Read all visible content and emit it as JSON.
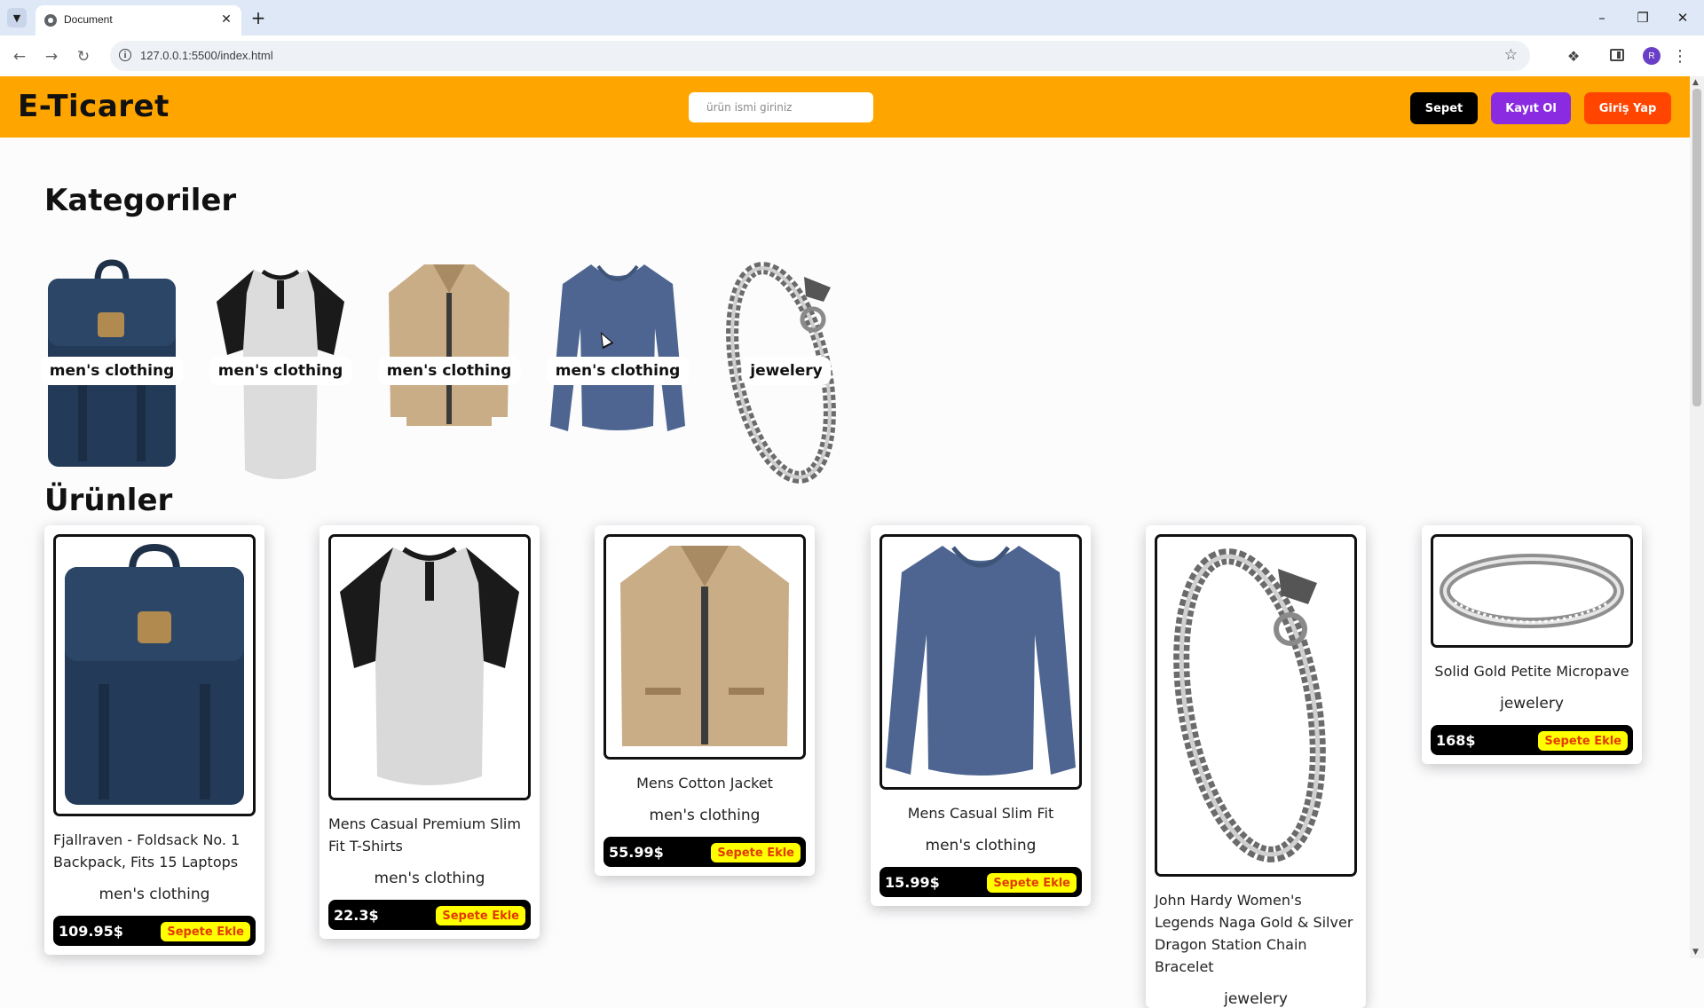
{
  "browser": {
    "tab_title": "Document",
    "url": "127.0.0.1:5500/index.html",
    "avatar_letter": "R"
  },
  "header": {
    "logo": "E-Ticaret",
    "search_placeholder": "ürün ismi giriniz",
    "cart_label": "Sepet",
    "register_label": "Kayıt Ol",
    "login_label": "Giriş Yap",
    "colors": {
      "bar": "#ffa500",
      "cart": "#000000",
      "register": "#8a2be2",
      "login": "#ff4500"
    }
  },
  "categories": {
    "title": "Kategoriler",
    "items": [
      {
        "label": "men's clothing",
        "icon": "backpack-image"
      },
      {
        "label": "men's clothing",
        "icon": "raglan-tshirt-image"
      },
      {
        "label": "men's clothing",
        "icon": "cotton-jacket-image"
      },
      {
        "label": "men's clothing",
        "icon": "blue-longsleeve-image"
      },
      {
        "label": "jewelery",
        "icon": "dragon-bracelet-image"
      }
    ]
  },
  "products": {
    "title": "Ürünler",
    "add_label": "Sepete Ekle",
    "items": [
      {
        "title": "Fjallraven - Foldsack No. 1 Backpack, Fits 15 Laptops",
        "category": "men's clothing",
        "price": "109.95$",
        "icon": "backpack-image"
      },
      {
        "title": "Mens Casual Premium Slim Fit T-Shirts",
        "category": "men's clothing",
        "price": "22.3$",
        "icon": "raglan-tshirt-image"
      },
      {
        "title": "Mens Cotton Jacket",
        "category": "men's clothing",
        "price": "55.99$",
        "icon": "cotton-jacket-image"
      },
      {
        "title": "Mens Casual Slim Fit",
        "category": "men's clothing",
        "price": "15.99$",
        "icon": "blue-longsleeve-image"
      },
      {
        "title": "John Hardy Women's Legends Naga Gold & Silver Dragon Station Chain Bracelet",
        "category": "jewelery",
        "price": "",
        "icon": "dragon-bracelet-image"
      },
      {
        "title": "Solid Gold Petite Micropave",
        "category": "jewelery",
        "price": "168$",
        "icon": "diamond-ring-image"
      }
    ]
  }
}
